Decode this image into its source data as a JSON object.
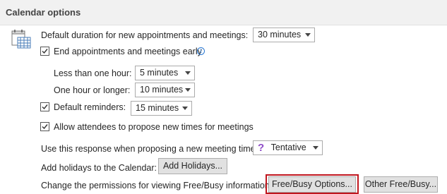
{
  "section": {
    "title": "Calendar options"
  },
  "duration": {
    "label": "Default duration for new appointments and meetings:",
    "value": "30 minutes"
  },
  "end_early": {
    "label": "End appointments and meetings early",
    "checked": true,
    "less_than_hour": {
      "label": "Less than one hour:",
      "value": "5 minutes"
    },
    "hour_or_longer": {
      "label": "One hour or longer:",
      "value": "10 minutes"
    }
  },
  "reminders": {
    "label": "Default reminders:",
    "checked": true,
    "value": "15 minutes"
  },
  "propose_times": {
    "label": "Allow attendees to propose new times for meetings",
    "checked": true
  },
  "response": {
    "label": "Use this response when proposing a new meeting time:",
    "value": "Tentative",
    "icon": "question-mark-icon"
  },
  "holidays": {
    "label": "Add holidays to the Calendar:",
    "button": "Add Holidays..."
  },
  "permissions": {
    "label": "Change the permissions for viewing Free/Busy information:",
    "button": "Free/Busy Options...",
    "other_button": "Other Free/Busy..."
  },
  "colors": {
    "highlight": "#c0161e",
    "info": "#2b79d3",
    "tentative": "#8e4cc7",
    "header_bg": "#f1f1f1"
  }
}
